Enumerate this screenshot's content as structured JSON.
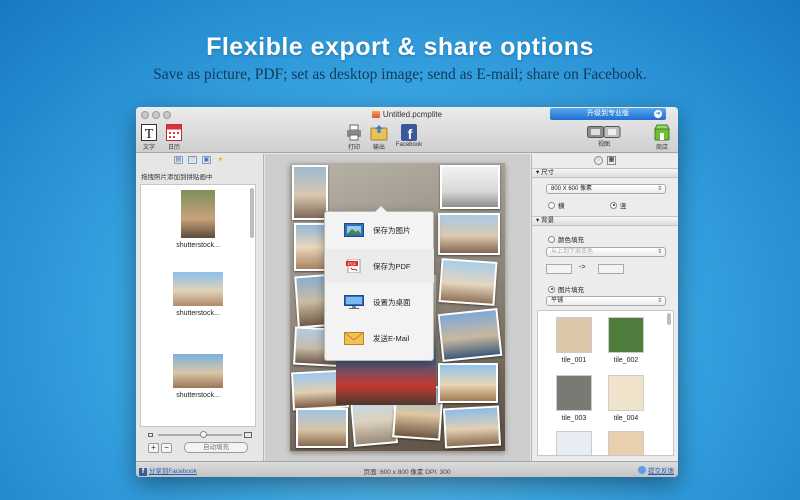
{
  "hero": {
    "title": "Flexible export & share options",
    "subtitle": "Save as picture, PDF; set as desktop image; send as E-mail; share on Facebook."
  },
  "window": {
    "title": "Untitled.pcmplite",
    "upgrade_label": "升级到专业版"
  },
  "toolbar": {
    "text_label": "文字",
    "calendar_label": "日历",
    "print_label": "打印",
    "export_label": "输出",
    "facebook_label": "Facebook",
    "view_label": "视图",
    "store_label": "商店"
  },
  "left_panel": {
    "hint": "拖拽照片添加到拼贴画中",
    "photos": [
      {
        "label": "shutterstock..."
      },
      {
        "label": "shutterstock..."
      },
      {
        "label": "shutterstock..."
      }
    ],
    "add_label": "+",
    "remove_label": "−",
    "autofill_label": "自动填充",
    "zoom_level": 0.55
  },
  "export_menu": {
    "items": [
      {
        "label": "保存为图片",
        "icon": "picture-icon"
      },
      {
        "label": "保存为PDF",
        "icon": "pdf-icon"
      },
      {
        "label": "设置为桌面",
        "icon": "desktop-icon"
      },
      {
        "label": "发送E-Mail",
        "icon": "envelope-icon"
      }
    ]
  },
  "right_panel": {
    "size_header": "尺寸",
    "size_value": "800 X 600 像素",
    "orientation_landscape": "横",
    "orientation_portrait": "竖",
    "orientation_selected": "portrait",
    "background_header": "背景",
    "color_fill_label": "颜色填充",
    "gradient_value": "从上到下渐变色",
    "arrow": "->",
    "image_fill_label": "图片填充",
    "fill_mode_value": "平铺",
    "tiles": [
      {
        "label": "tile_001",
        "color": "#dcc7a8"
      },
      {
        "label": "tile_002",
        "color": "#4f7d3e"
      },
      {
        "label": "tile_003",
        "color": "#7a7a74"
      },
      {
        "label": "tile_004",
        "color": "#efe3cc"
      }
    ]
  },
  "statusbar": {
    "share_label": "分享到Facebook",
    "page_info": "页面: 600 x 800 像素  DPI: 300",
    "feedback_label": "提交反馈"
  },
  "colors": {
    "accent": "#1d6fd1",
    "facebook": "#3b5998"
  }
}
